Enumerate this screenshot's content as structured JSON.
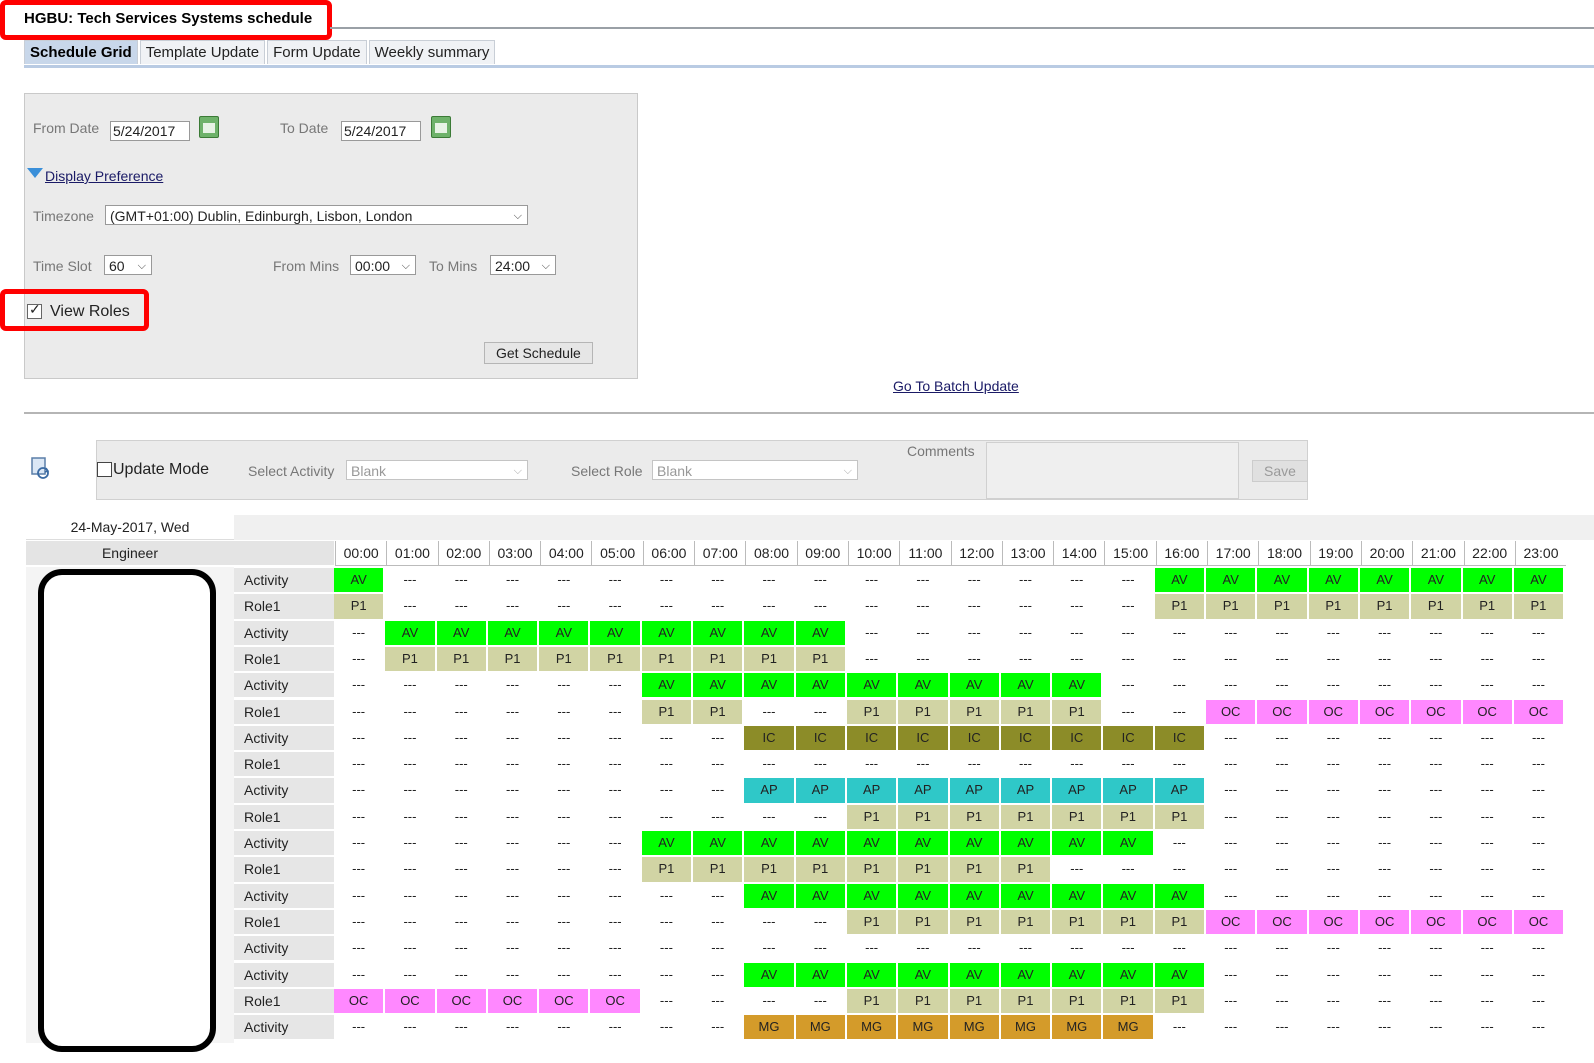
{
  "page": {
    "title": "HGBU: Tech Services Systems schedule"
  },
  "tabs": [
    {
      "label": "Schedule Grid",
      "active": true
    },
    {
      "label": "Template Update",
      "active": false
    },
    {
      "label": "Form Update",
      "active": false
    },
    {
      "label": "Weekly summary",
      "active": false
    }
  ],
  "filters": {
    "from_date_label": "From Date",
    "from_date": "5/24/2017",
    "to_date_label": "To Date",
    "to_date": "5/24/2017",
    "display_preference": "Display Preference",
    "timezone_label": "Timezone",
    "timezone": "(GMT+01:00) Dublin, Edinburgh, Lisbon, London",
    "time_slot_label": "Time Slot",
    "time_slot": "60",
    "from_mins_label": "From Mins",
    "from_mins": "00:00",
    "to_mins_label": "To Mins",
    "to_mins": "24:00",
    "view_roles_label": "View Roles",
    "view_roles_checked": true,
    "get_schedule": "Get Schedule"
  },
  "batch_link": "Go To Batch Update",
  "update_bar": {
    "update_mode_label": "Update Mode",
    "select_activity_label": "Select Activity",
    "select_activity": "Blank",
    "select_role_label": "Select Role",
    "select_role": "Blank",
    "comments_label": "Comments",
    "save": "Save"
  },
  "grid": {
    "date_header": "24-May-2017, Wed",
    "engineer_header": "Engineer",
    "hours": [
      "00:00",
      "01:00",
      "02:00",
      "03:00",
      "04:00",
      "05:00",
      "06:00",
      "07:00",
      "08:00",
      "09:00",
      "10:00",
      "11:00",
      "12:00",
      "13:00",
      "14:00",
      "15:00",
      "16:00",
      "17:00",
      "18:00",
      "19:00",
      "20:00",
      "21:00",
      "22:00",
      "23:00"
    ],
    "colors": {
      "AV": "#00ff00",
      "P1": "#d1d4a4",
      "OC": "#ff88ff",
      "IC": "#8c8c28",
      "AP": "#2fc8c8",
      "MG": "#d49b2a",
      "---": ""
    },
    "rows": [
      {
        "label": "Activity",
        "cells": [
          "AV",
          "---",
          "---",
          "---",
          "---",
          "---",
          "---",
          "---",
          "---",
          "---",
          "---",
          "---",
          "---",
          "---",
          "---",
          "---",
          "AV",
          "AV",
          "AV",
          "AV",
          "AV",
          "AV",
          "AV",
          "AV"
        ]
      },
      {
        "label": "Role1",
        "cells": [
          "P1",
          "---",
          "---",
          "---",
          "---",
          "---",
          "---",
          "---",
          "---",
          "---",
          "---",
          "---",
          "---",
          "---",
          "---",
          "---",
          "P1",
          "P1",
          "P1",
          "P1",
          "P1",
          "P1",
          "P1",
          "P1"
        ]
      },
      {
        "label": "Activity",
        "cells": [
          "---",
          "AV",
          "AV",
          "AV",
          "AV",
          "AV",
          "AV",
          "AV",
          "AV",
          "AV",
          "---",
          "---",
          "---",
          "---",
          "---",
          "---",
          "---",
          "---",
          "---",
          "---",
          "---",
          "---",
          "---",
          "---"
        ]
      },
      {
        "label": "Role1",
        "cells": [
          "---",
          "P1",
          "P1",
          "P1",
          "P1",
          "P1",
          "P1",
          "P1",
          "P1",
          "P1",
          "---",
          "---",
          "---",
          "---",
          "---",
          "---",
          "---",
          "---",
          "---",
          "---",
          "---",
          "---",
          "---",
          "---"
        ]
      },
      {
        "label": "Activity",
        "cells": [
          "---",
          "---",
          "---",
          "---",
          "---",
          "---",
          "AV",
          "AV",
          "AV",
          "AV",
          "AV",
          "AV",
          "AV",
          "AV",
          "AV",
          "---",
          "---",
          "---",
          "---",
          "---",
          "---",
          "---",
          "---",
          "---"
        ]
      },
      {
        "label": "Role1",
        "cells": [
          "---",
          "---",
          "---",
          "---",
          "---",
          "---",
          "P1",
          "P1",
          "---",
          "---",
          "P1",
          "P1",
          "P1",
          "P1",
          "P1",
          "---",
          "---",
          "OC",
          "OC",
          "OC",
          "OC",
          "OC",
          "OC",
          "OC"
        ]
      },
      {
        "label": "Activity",
        "cells": [
          "---",
          "---",
          "---",
          "---",
          "---",
          "---",
          "---",
          "---",
          "IC",
          "IC",
          "IC",
          "IC",
          "IC",
          "IC",
          "IC",
          "IC",
          "IC",
          "---",
          "---",
          "---",
          "---",
          "---",
          "---",
          "---"
        ]
      },
      {
        "label": "Role1",
        "cells": [
          "---",
          "---",
          "---",
          "---",
          "---",
          "---",
          "---",
          "---",
          "---",
          "---",
          "---",
          "---",
          "---",
          "---",
          "---",
          "---",
          "---",
          "---",
          "---",
          "---",
          "---",
          "---",
          "---",
          "---"
        ]
      },
      {
        "label": "Activity",
        "cells": [
          "---",
          "---",
          "---",
          "---",
          "---",
          "---",
          "---",
          "---",
          "AP",
          "AP",
          "AP",
          "AP",
          "AP",
          "AP",
          "AP",
          "AP",
          "AP",
          "---",
          "---",
          "---",
          "---",
          "---",
          "---",
          "---"
        ]
      },
      {
        "label": "Role1",
        "cells": [
          "---",
          "---",
          "---",
          "---",
          "---",
          "---",
          "---",
          "---",
          "---",
          "---",
          "P1",
          "P1",
          "P1",
          "P1",
          "P1",
          "P1",
          "P1",
          "---",
          "---",
          "---",
          "---",
          "---",
          "---",
          "---"
        ]
      },
      {
        "label": "Activity",
        "cells": [
          "---",
          "---",
          "---",
          "---",
          "---",
          "---",
          "AV",
          "AV",
          "AV",
          "AV",
          "AV",
          "AV",
          "AV",
          "AV",
          "AV",
          "AV",
          "---",
          "---",
          "---",
          "---",
          "---",
          "---",
          "---",
          "---"
        ]
      },
      {
        "label": "Role1",
        "cells": [
          "---",
          "---",
          "---",
          "---",
          "---",
          "---",
          "P1",
          "P1",
          "P1",
          "P1",
          "P1",
          "P1",
          "P1",
          "P1",
          "---",
          "---",
          "---",
          "---",
          "---",
          "---",
          "---",
          "---",
          "---",
          "---"
        ]
      },
      {
        "label": "Activity",
        "cells": [
          "---",
          "---",
          "---",
          "---",
          "---",
          "---",
          "---",
          "---",
          "AV",
          "AV",
          "AV",
          "AV",
          "AV",
          "AV",
          "AV",
          "AV",
          "AV",
          "---",
          "---",
          "---",
          "---",
          "---",
          "---",
          "---"
        ]
      },
      {
        "label": "Role1",
        "cells": [
          "---",
          "---",
          "---",
          "---",
          "---",
          "---",
          "---",
          "---",
          "---",
          "---",
          "P1",
          "P1",
          "P1",
          "P1",
          "P1",
          "P1",
          "P1",
          "OC",
          "OC",
          "OC",
          "OC",
          "OC",
          "OC",
          "OC"
        ]
      },
      {
        "label": "Activity",
        "cells": [
          "---",
          "---",
          "---",
          "---",
          "---",
          "---",
          "---",
          "---",
          "---",
          "---",
          "---",
          "---",
          "---",
          "---",
          "---",
          "---",
          "---",
          "---",
          "---",
          "---",
          "---",
          "---",
          "---",
          "---"
        ]
      },
      {
        "label": "Activity",
        "cells": [
          "---",
          "---",
          "---",
          "---",
          "---",
          "---",
          "---",
          "---",
          "AV",
          "AV",
          "AV",
          "AV",
          "AV",
          "AV",
          "AV",
          "AV",
          "AV",
          "---",
          "---",
          "---",
          "---",
          "---",
          "---",
          "---"
        ]
      },
      {
        "label": "Role1",
        "cells": [
          "OC",
          "OC",
          "OC",
          "OC",
          "OC",
          "OC",
          "---",
          "---",
          "---",
          "---",
          "P1",
          "P1",
          "P1",
          "P1",
          "P1",
          "P1",
          "P1",
          "---",
          "---",
          "---",
          "---",
          "---",
          "---",
          "---"
        ]
      },
      {
        "label": "Activity",
        "cells": [
          "---",
          "---",
          "---",
          "---",
          "---",
          "---",
          "---",
          "---",
          "MG",
          "MG",
          "MG",
          "MG",
          "MG",
          "MG",
          "MG",
          "MG",
          "---",
          "---",
          "---",
          "---",
          "---",
          "---",
          "---",
          "---"
        ]
      }
    ]
  }
}
